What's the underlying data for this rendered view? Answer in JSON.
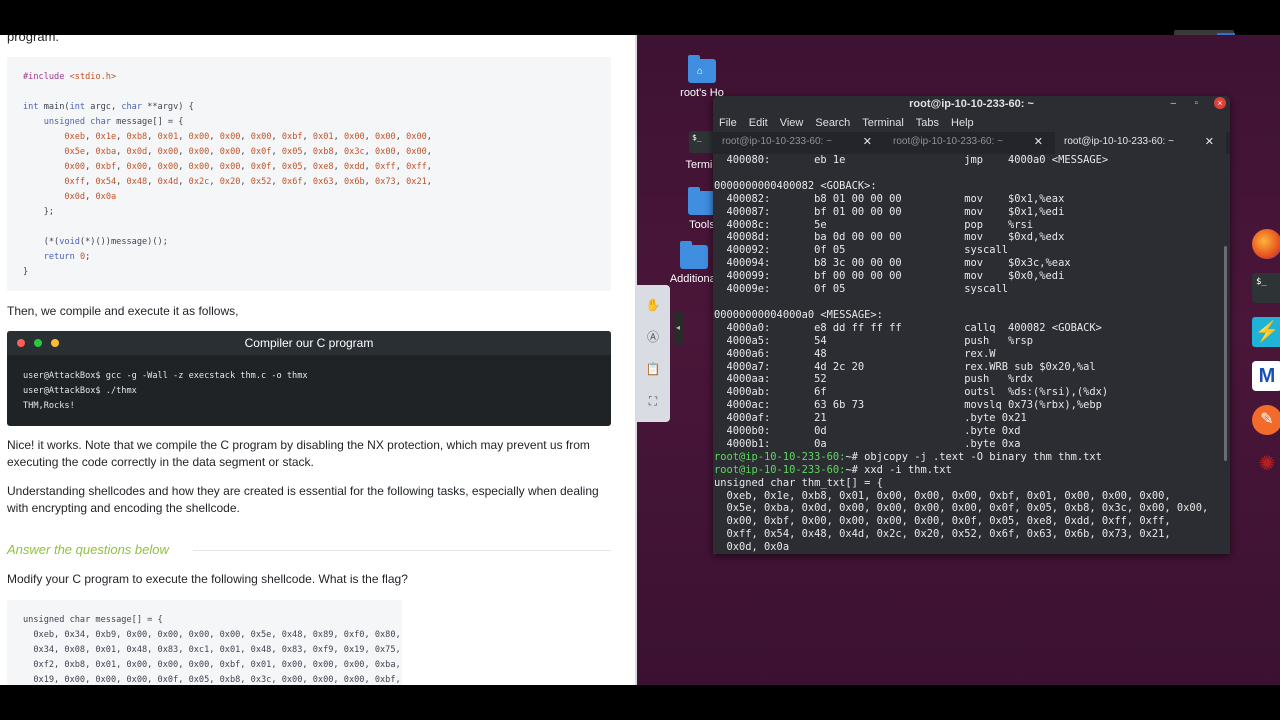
{
  "article": {
    "intro_cut": "program.",
    "c_program_code": [
      "#include <stdio.h>",
      "",
      "int main(int argc, char **argv) {",
      "    unsigned char message[] = {",
      "        0xeb, 0x1e, 0xb8, 0x01, 0x00, 0x00, 0x00, 0xbf, 0x01, 0x00, 0x00, 0x00,",
      "        0x5e, 0xba, 0x0d, 0x00, 0x00, 0x00, 0x0f, 0x05, 0xb8, 0x3c, 0x00, 0x00,",
      "        0x00, 0xbf, 0x00, 0x00, 0x00, 0x00, 0x0f, 0x05, 0xe8, 0xdd, 0xff, 0xff,",
      "        0xff, 0x54, 0x48, 0x4d, 0x2c, 0x20, 0x52, 0x6f, 0x63, 0x6b, 0x73, 0x21,",
      "        0x0d, 0x0a",
      "    };",
      "",
      "    (*(void(*)())message)();",
      "    return 0;",
      "}"
    ],
    "compile_intro": "Then, we compile and execute it as follows,",
    "terminal_card": {
      "title": "Compiler our C program",
      "lines": [
        "user@AttackBox$ gcc -g -Wall -z execstack thm.c -o thmx",
        "user@AttackBox$ ./thmx",
        "THM,Rocks!"
      ]
    },
    "nice_paragraph": "Nice! it works. Note that we compile the C program by disabling the NX protection, which may prevent us from executing the code correctly in the data segment or stack.",
    "understanding_paragraph": "Understanding shellcodes and how they are created is essential for the following tasks, especially when dealing with encrypting and encoding the shellcode.",
    "answer_heading": "Answer the questions below",
    "question": "Modify your C program to execute the following shellcode. What is the flag?",
    "shellcode_code": [
      "unsigned char message[] = {",
      "  0xeb, 0x34, 0xb9, 0x00, 0x00, 0x00, 0x00, 0x5e, 0x48, 0x89, 0xf0, 0x80,",
      "  0x34, 0x08, 0x01, 0x48, 0x83, 0xc1, 0x01, 0x48, 0x83, 0xf9, 0x19, 0x75,",
      "  0xf2, 0xb8, 0x01, 0x00, 0x00, 0x00, 0xbf, 0x01, 0x00, 0x00, 0x00, 0xba,",
      "  0x19, 0x00, 0x00, 0x00, 0x0f, 0x05, 0xb8, 0x3c, 0x00, 0x00, 0x00, 0xbf,"
    ]
  },
  "desktop": {
    "icons": [
      {
        "label": "root's Ho",
        "icon": "home-folder-icon"
      },
      {
        "label": "Termin",
        "icon": "terminal-icon"
      },
      {
        "label": "Tools",
        "icon": "folder-icon"
      },
      {
        "label": "Additional",
        "icon": "folder-icon"
      }
    ],
    "side_tools": [
      "hand-icon",
      "text-icon",
      "clipboard-icon",
      "fullscreen-icon"
    ],
    "dock_apps": [
      "firefox-icon",
      "terminal-icon",
      "burp-icon",
      "malwarebytes-icon",
      "postman-icon",
      "red-app-icon"
    ],
    "colors": {
      "wallpaper": "#461537",
      "prompt": "#5fd75f",
      "window": "#2b2d33"
    }
  },
  "terminal": {
    "title": "root@ip-10-10-233-60: ~",
    "menu": [
      "File",
      "Edit",
      "View",
      "Search",
      "Terminal",
      "Tabs",
      "Help"
    ],
    "tabs": [
      {
        "label": "root@ip-10-10-233-60: ~",
        "active": false
      },
      {
        "label": "root@ip-10-10-233-60: ~",
        "active": false
      },
      {
        "label": "root@ip-10-10-233-60: ~",
        "active": true
      }
    ],
    "lines_top": [
      "  400080:       eb 1e                   jmp    4000a0 <MESSAGE>",
      "",
      "0000000000400082 <GOBACK>:",
      "  400082:       b8 01 00 00 00          mov    $0x1,%eax",
      "  400087:       bf 01 00 00 00          mov    $0x1,%edi",
      "  40008c:       5e                      pop    %rsi",
      "  40008d:       ba 0d 00 00 00          mov    $0xd,%edx",
      "  400092:       0f 05                   syscall",
      "  400094:       b8 3c 00 00 00          mov    $0x3c,%eax",
      "  400099:       bf 00 00 00 00          mov    $0x0,%edi",
      "  40009e:       0f 05                   syscall",
      "",
      "00000000004000a0 <MESSAGE>:",
      "  4000a0:       e8 dd ff ff ff          callq  400082 <GOBACK>",
      "  4000a5:       54                      push   %rsp",
      "  4000a6:       48                      rex.W",
      "  4000a7:       4d 2c 20                rex.WRB sub $0x20,%al",
      "  4000aa:       52                      push   %rdx",
      "  4000ab:       6f                      outsl  %ds:(%rsi),(%dx)",
      "  4000ac:       63 6b 73                movslq 0x73(%rbx),%ebp",
      "  4000af:       21                      .byte 0x21",
      "  4000b0:       0d                      .byte 0xd",
      "  4000b1:       0a                      .byte 0xa"
    ],
    "prompt": "root@ip-10-10-233-60:",
    "prompt_suffix": "~# ",
    "cmd1": "objcopy -j .text -O binary thm thm.txt",
    "cmd2": "xxd -i thm.txt",
    "lines_bottom": [
      "unsigned char thm_txt[] = {",
      "  0xeb, 0x1e, 0xb8, 0x01, 0x00, 0x00, 0x00, 0xbf, 0x01, 0x00, 0x00, 0x00,",
      "  0x5e, 0xba, 0x0d, 0x00, 0x00, 0x00, 0x00, 0x0f, 0x05, 0xb8, 0x3c, 0x00, 0x00,",
      "  0x00, 0xbf, 0x00, 0x00, 0x00, 0x00, 0x0f, 0x05, 0xe8, 0xdd, 0xff, 0xff,",
      "  0xff, 0x54, 0x48, 0x4d, 0x2c, 0x20, 0x52, 0x6f, 0x63, 0x6b, 0x73, 0x21,",
      "  0x0d, 0x0a"
    ]
  }
}
